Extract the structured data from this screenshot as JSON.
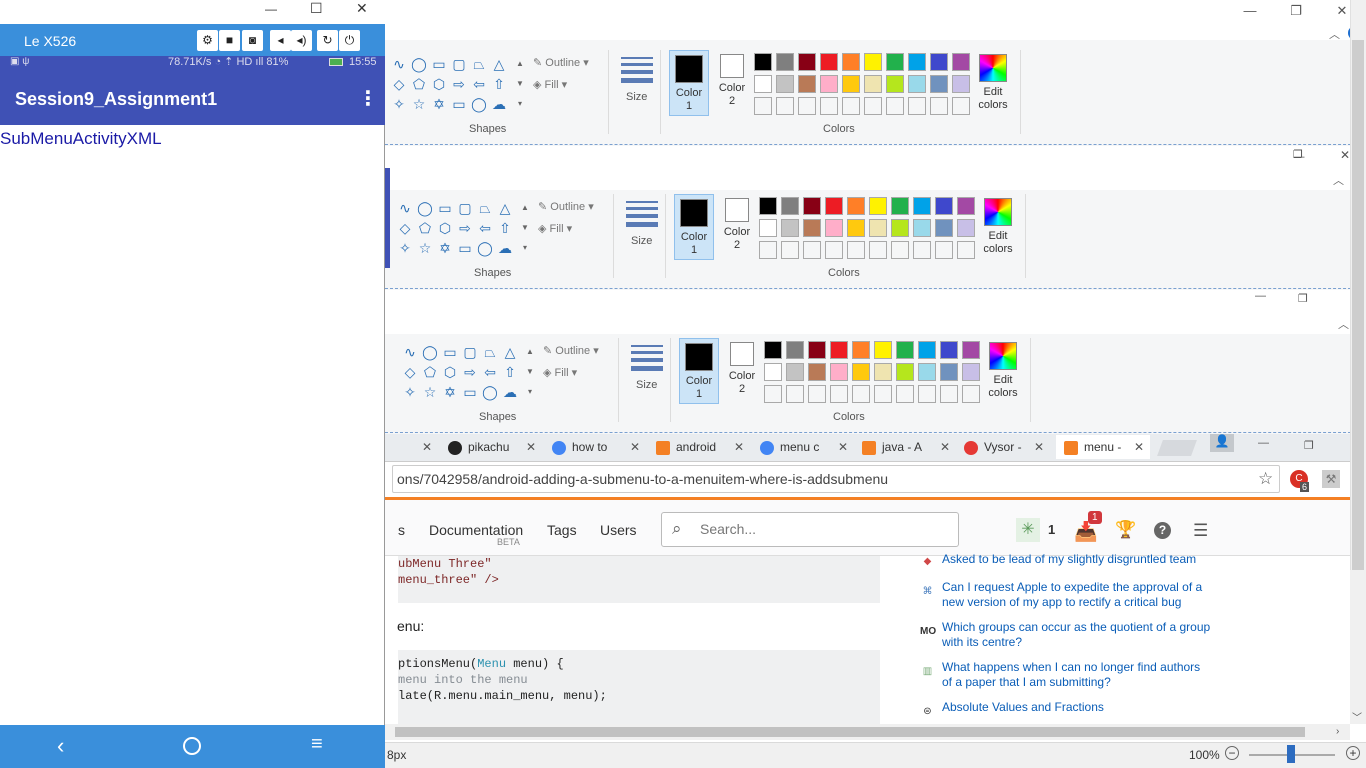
{
  "phone": {
    "device_name": "Le X526",
    "status_text": "78.71K/s ◔ ⇡ HD ıll 81%",
    "clock": "15:55",
    "app_title": "Session9_Assignment1",
    "menu_item": "SubMenuActivityXML",
    "toolbar_icons": [
      "gear-icon",
      "camera-video-icon",
      "screenshot-icon",
      "volume-down-icon",
      "volume-up-icon",
      "rotate-icon",
      "power-icon"
    ]
  },
  "paint": {
    "shapes_label": "Shapes",
    "outline_label": "Outline",
    "fill_label": "Fill",
    "size_label": "Size",
    "color1_label": "Color",
    "color1_num": "1",
    "color2_label": "Color",
    "color2_num": "2",
    "colors_label": "Colors",
    "edit_label": "Edit",
    "edit_label2": "colors",
    "palette_row1": [
      "#000000",
      "#7f7f7f",
      "#880015",
      "#ed1c24",
      "#ff7f27",
      "#fff200",
      "#22b14c",
      "#00a2e8",
      "#3f48cc",
      "#a349a4"
    ],
    "palette_row2": [
      "#ffffff",
      "#c3c3c3",
      "#b97a57",
      "#ffaec9",
      "#ffc90e",
      "#efe4b0",
      "#b5e61d",
      "#99d9ea",
      "#7092be",
      "#c8bfe7"
    ]
  },
  "browser": {
    "tabs": [
      {
        "label": "pikachu",
        "icon": "github-icon"
      },
      {
        "label": "how to",
        "icon": "google-icon"
      },
      {
        "label": "android",
        "icon": "stackoverflow-icon"
      },
      {
        "label": "menu c",
        "icon": "google-icon"
      },
      {
        "label": "java - A",
        "icon": "stackoverflow-icon"
      },
      {
        "label": "Vysor -",
        "icon": "vysor-icon"
      },
      {
        "label": "menu -",
        "icon": "stackoverflow-icon"
      }
    ],
    "url": "ons/7042958/android-adding-a-submenu-to-a-menuitem-where-is-addsubmenu",
    "ext_badge": "6"
  },
  "so": {
    "nav_s": "s",
    "documentation": "Documentation",
    "beta": "BETA",
    "tags": "Tags",
    "users": "Users",
    "search_placeholder": "Search...",
    "rep": "1",
    "inbox_badge": "1",
    "code1_line1": "ubMenu Three\"",
    "code1_line2": "menu_three\" />",
    "text_menu": "enu:",
    "code2_line1a": "ptionsMenu(",
    "code2_line1b": "Menu",
    "code2_line1c": " menu) {",
    "code2_line2": "menu into the menu",
    "code2_line3": "late(R.menu.main_menu, menu);",
    "hot": [
      "Asked to be lead of my slightly disgruntled team",
      "Can I request Apple to expedite the approval of a new version of my app to rectify a critical bug",
      "Which groups can occur as the quotient of a group with its centre?",
      "What happens when I can no longer find authors of a paper that I am submitting?",
      "Absolute Values and Fractions"
    ]
  },
  "statusbar": {
    "size": "8px",
    "zoom": "100%"
  }
}
